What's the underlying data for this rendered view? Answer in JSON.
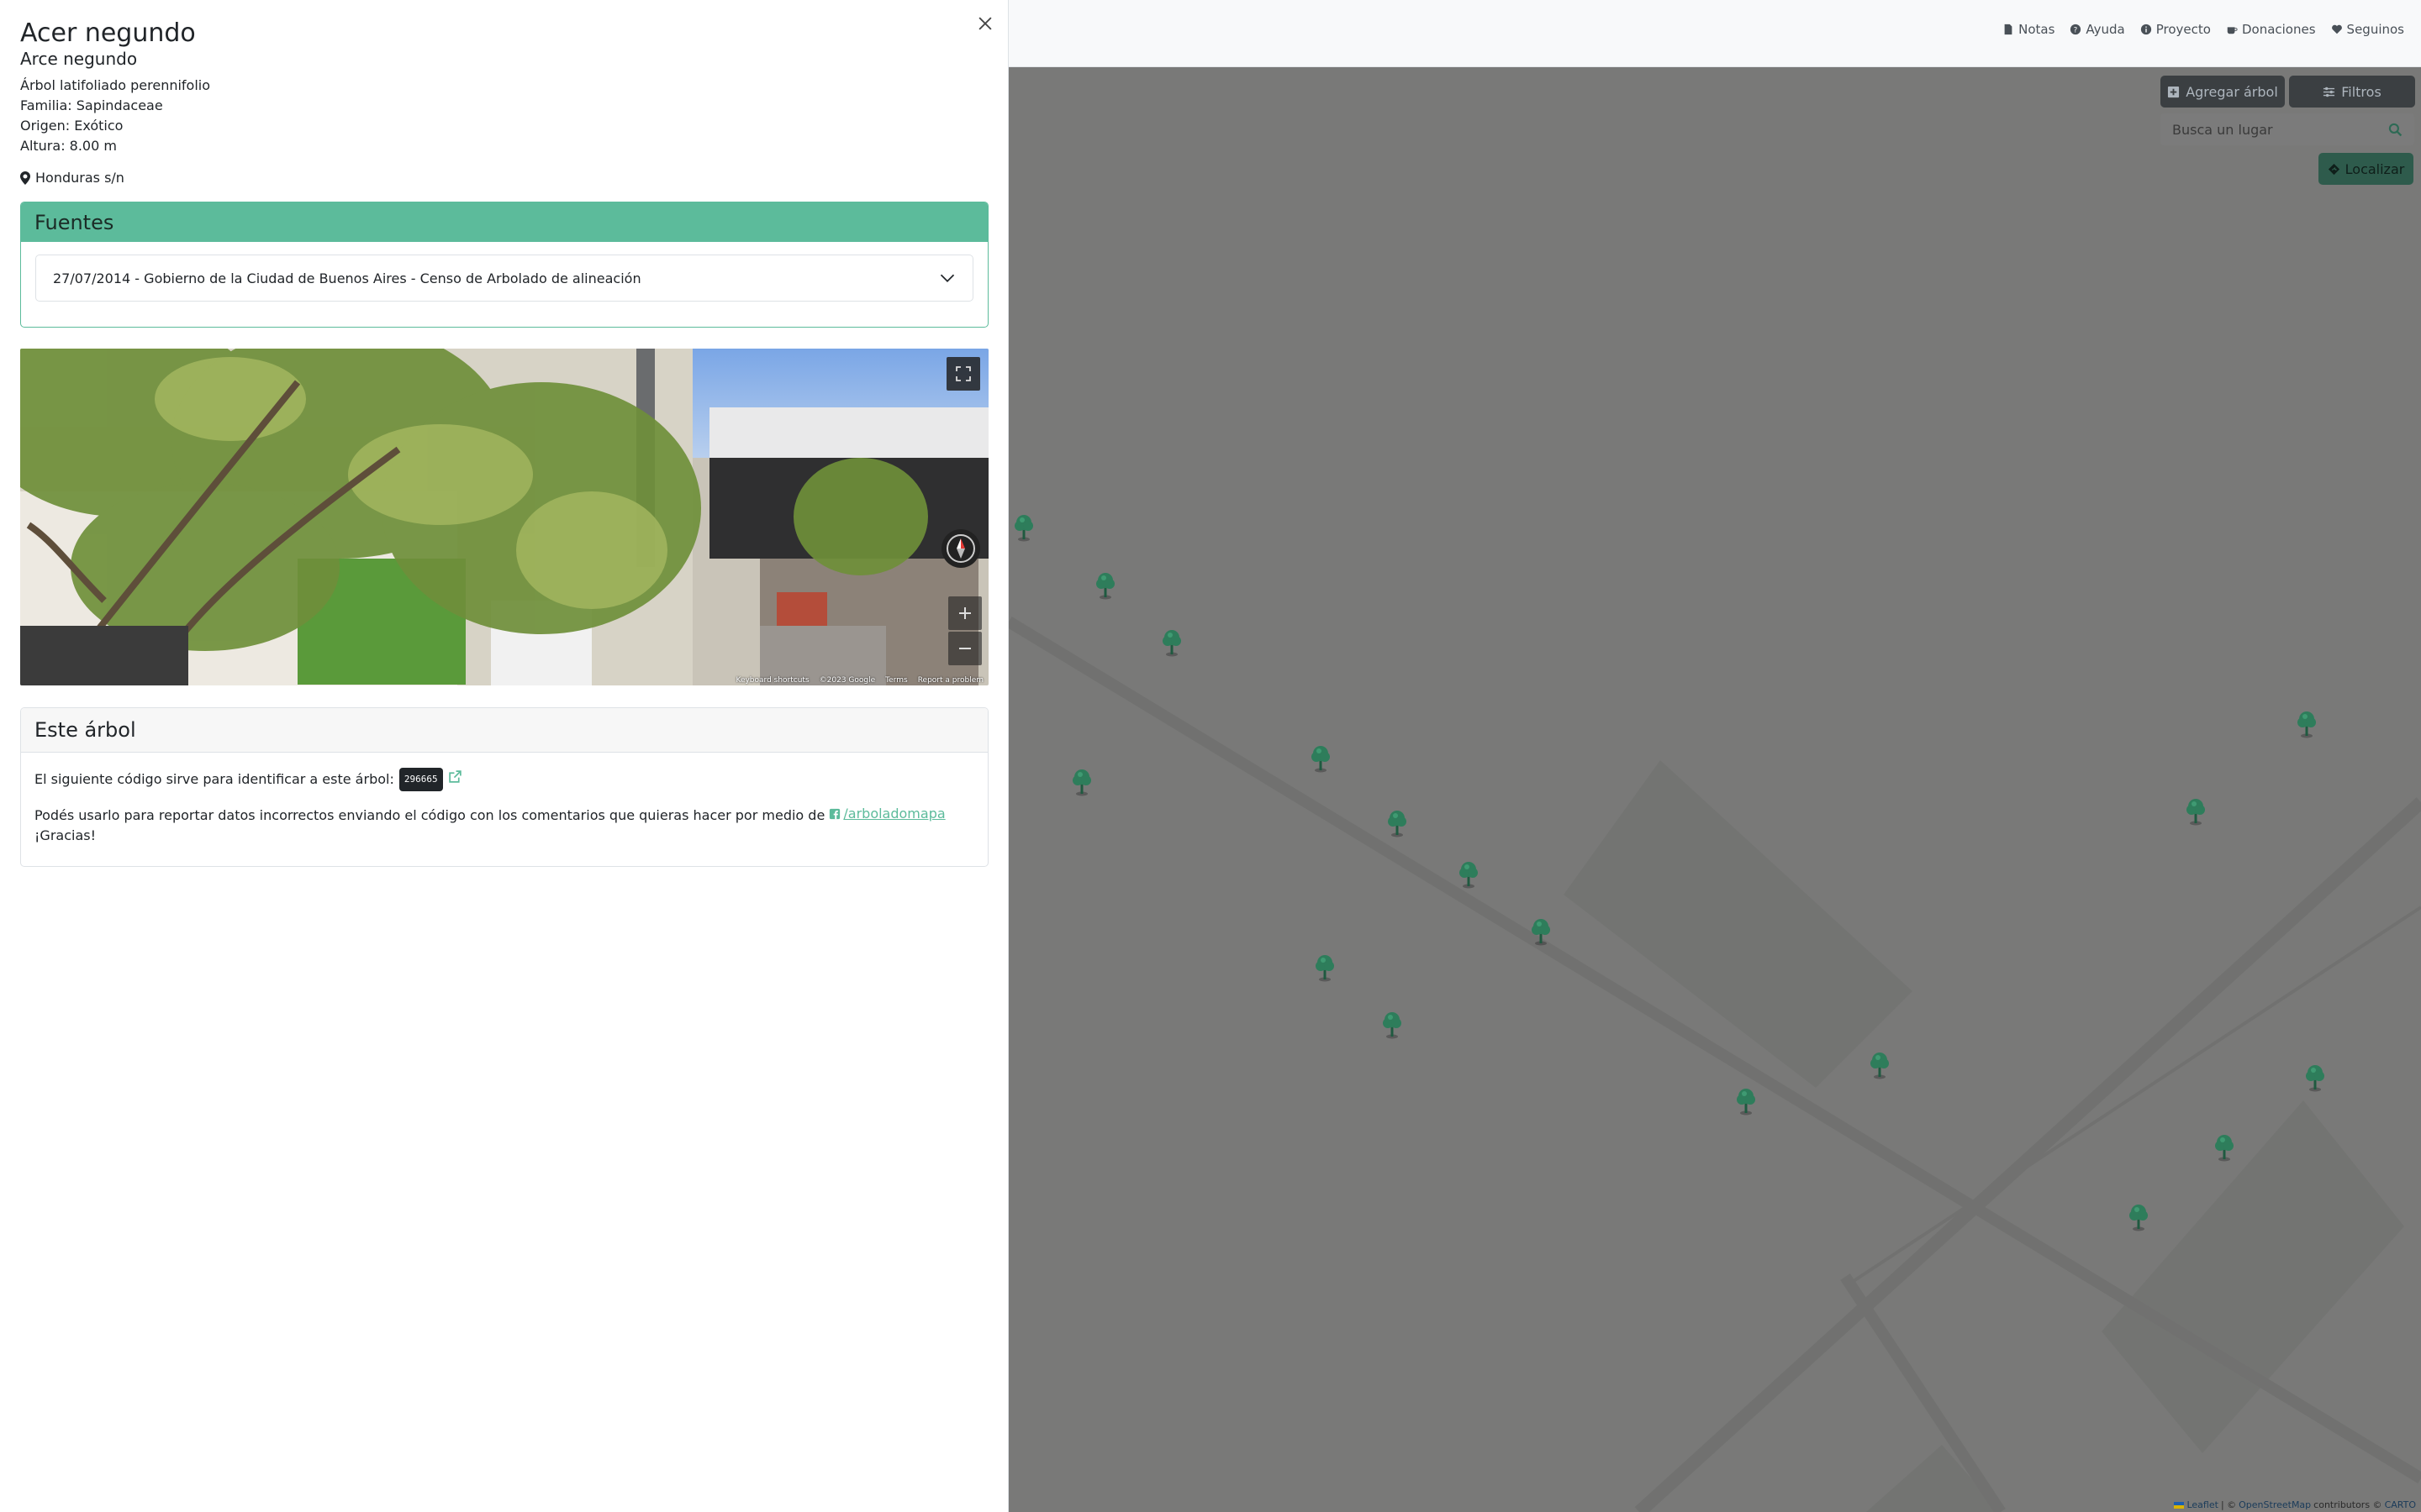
{
  "tree": {
    "common_name": "Acer negundo",
    "scientific_name": "Arce negundo",
    "type": "Árbol latifoliado perennifolio",
    "family": "Familia: Sapindaceae",
    "origin": "Origen: Exótico",
    "height": "Altura: 8.00 m",
    "address": "Honduras s/n"
  },
  "sources": {
    "header": "Fuentes",
    "items": [
      "27/07/2014 - Gobierno de la Ciudad de Buenos Aires - Censo de Arbolado de alineación"
    ]
  },
  "streetview": {
    "footer": [
      "Keyboard shortcuts",
      "©2023 Google",
      "Terms",
      "Report a problem"
    ]
  },
  "este_arbol": {
    "header": "Este árbol",
    "code_text": "El siguiente código sirve para identificar a este árbol:",
    "code": "296665",
    "report_text": "Podés usarlo para reportar datos incorrectos enviando el código con los comentarios que quieras hacer por medio de",
    "facebook_link": "/arboladomapa",
    "thanks": "¡Gracias!"
  },
  "navbar": {
    "links": [
      "Notas",
      "Ayuda",
      "Proyecto",
      "Donaciones",
      "Seguinos"
    ]
  },
  "map": {
    "add_button": "Agregar árbol",
    "filter_button": "Filtros",
    "search_placeholder": "Busca un lugar",
    "locate_button": "Localizar",
    "attribution": {
      "leaflet": "Leaflet",
      "sep": "| ©",
      "osm": "OpenStreetMap",
      "contributors": "contributors ©",
      "carto": "CARTO"
    }
  },
  "colors": {
    "accent": "#5cbb9b",
    "tree_marker": "#2e7d5b",
    "overlay": "rgba(0,0,0,0.5)"
  }
}
